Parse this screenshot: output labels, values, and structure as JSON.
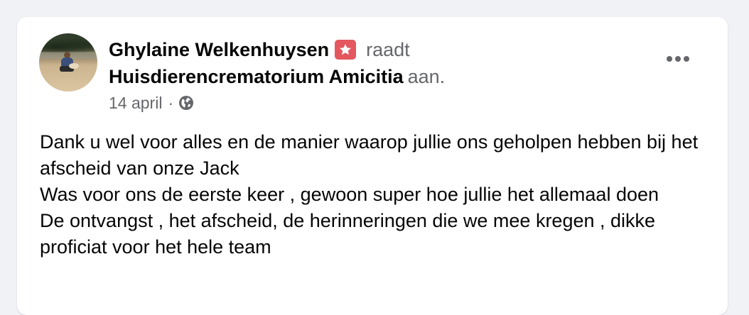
{
  "post": {
    "author": "Ghylaine Welkenhuysen",
    "verb": "raadt",
    "page_name": "Huisdierencrematorium Amicitia",
    "suffix": "aan.",
    "date": "14 april",
    "separator": "·",
    "privacy_icon": "globe-icon",
    "recommend_icon": "star-badge-icon",
    "menu_icon": "more-horizontal-icon",
    "body_lines": [
      "Dank u wel voor alles en de manier waarop jullie ons geholpen hebben bij het afscheid van onze Jack",
      "Was voor ons de eerste keer , gewoon super hoe jullie het allemaal doen",
      "De ontvangst , het afscheid, de herinneringen die we mee kregen , dikke proficiat voor het hele team"
    ]
  },
  "colors": {
    "background": "#f0f2f5",
    "card": "#ffffff",
    "primary_text": "#050505",
    "secondary_text": "#65676b",
    "recommend_badge": "#e4575f"
  }
}
